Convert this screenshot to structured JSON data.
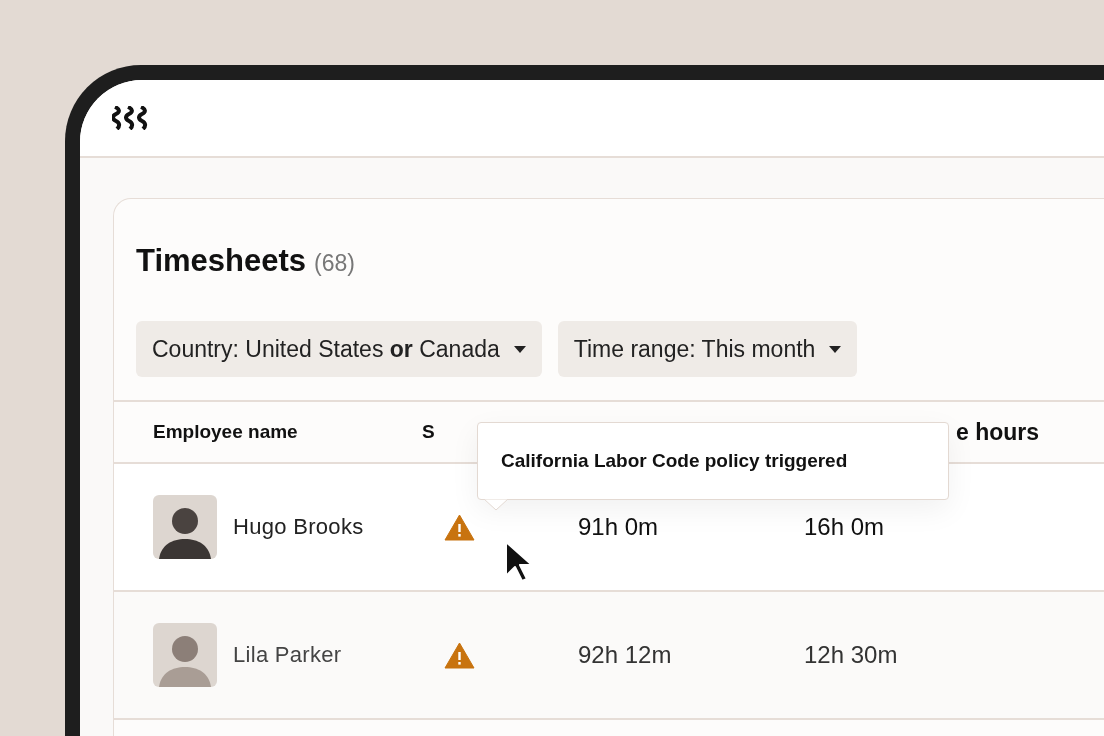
{
  "page": {
    "title": "Timesheets",
    "count": "(68)"
  },
  "filters": [
    {
      "text": "Country: United States **or** Canada"
    },
    {
      "text": "Time range: This month"
    }
  ],
  "table": {
    "columns": [
      "Employee name",
      "S",
      "",
      "e hours"
    ],
    "rows": [
      {
        "name": "Hugo Brooks",
        "kind": "warning",
        "column_3": "91h 0m",
        "column_4": "16h 0m",
        "hovered": true
      },
      {
        "name": "Lila Parker",
        "kind": "warning",
        "column_3": "92h 12m",
        "column_4": "12h 30m",
        "hovered": false
      }
    ]
  },
  "tooltip": {
    "text": "California Labor Code policy triggered"
  }
}
